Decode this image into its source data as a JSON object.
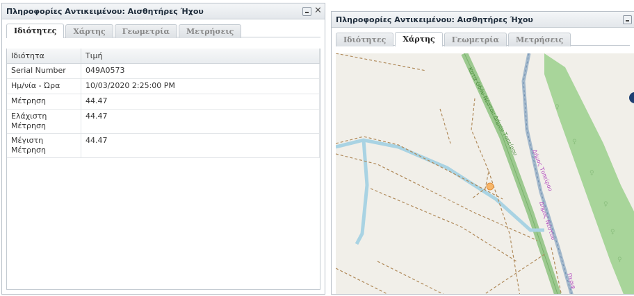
{
  "panel1": {
    "title": "Πληροφορίες Αντικειμένου: Αισθητήρες Ήχου",
    "tabs": [
      "Ιδιότητες",
      "Χάρτης",
      "Γεωμετρία",
      "Μετρήσεις"
    ],
    "active_tab": "Ιδιότητες",
    "columns": [
      "Ιδιότητα",
      "Τιμή"
    ],
    "rows": [
      [
        "Serial Number",
        "049A0573"
      ],
      [
        "Ημ/νία - Ώρα",
        "10/03/2020 2:25:00 PM"
      ],
      [
        "Μέτρηση",
        "44.47"
      ],
      [
        "Ελάχιστη Μέτρηση",
        "44.47"
      ],
      [
        "Μέγιστη Μέτρηση",
        "44.47"
      ]
    ]
  },
  "panel2": {
    "title": "Πληροφορίες Αντικειμένου: Αισθητήρες Ήχου",
    "tabs": [
      "Ιδιότητες",
      "Χάρτης",
      "Γεωμετρία",
      "Μετρήσεις"
    ],
    "active_tab": "Χάρτης",
    "map_labels": {
      "road_green": "Κατά Οδόυ Νέστου Δήμου Τοπείρου",
      "road_pink": "Δήμος Τοπείρου",
      "road_pink2": "Δήμος Νέστου",
      "corner": "Περιφ"
    },
    "colors": {
      "map_bg": "#f1efe9",
      "forest": "#a8d59a",
      "water": "#a9d3e3",
      "path": "#b08a5a",
      "boundary": "#c46bd0",
      "marker": "#f7b668"
    }
  }
}
